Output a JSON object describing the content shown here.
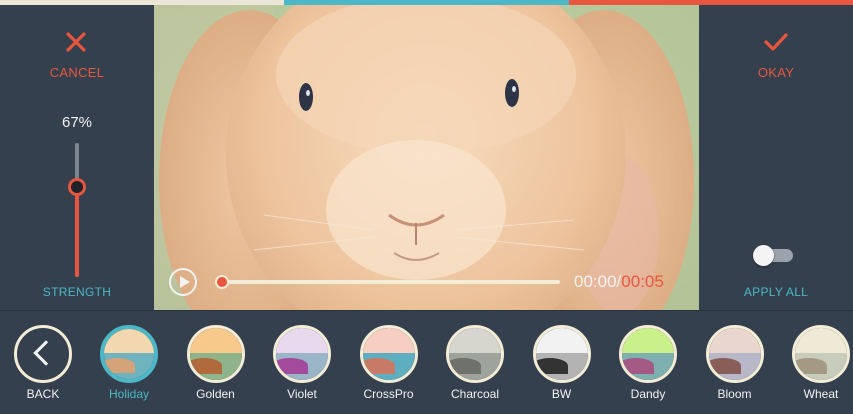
{
  "colors": {
    "panel": "#34404d",
    "accent_red": "#e8563f",
    "accent_teal": "#4bb7c7",
    "cream": "#f3ecd6",
    "strip_cream": "#ece6d6",
    "strip_teal": "#4bb7c7",
    "strip_red": "#e8563f"
  },
  "left_panel": {
    "cancel_icon": "close-icon",
    "cancel_label": "CANCEL",
    "strength_value": "67%",
    "strength_level": 0.67,
    "strength_label": "STRENGTH"
  },
  "right_panel": {
    "okay_icon": "check-icon",
    "okay_label": "OKAY",
    "apply_all_enabled": false,
    "apply_all_label": "APPLY ALL"
  },
  "player": {
    "play_icon": "play-icon",
    "current_time": "00:00",
    "separator": "/",
    "total_time": "00:05",
    "progress": 0.0
  },
  "filters": {
    "back_icon": "chevron-left-icon",
    "back_label": "BACK",
    "items": [
      {
        "label": "Holiday",
        "selected": true,
        "sky": "#f2d7b0",
        "sea": "#6fb3bf",
        "rocks": "#d4a37a"
      },
      {
        "label": "Golden",
        "selected": false,
        "sky": "#f7c98a",
        "sea": "#8fb38a",
        "rocks": "#b06a3c"
      },
      {
        "label": "Violet",
        "selected": false,
        "sky": "#e9d9ef",
        "sea": "#9ab4c8",
        "rocks": "#a34a9c"
      },
      {
        "label": "CrossPro",
        "selected": false,
        "sky": "#f6cfc2",
        "sea": "#5faec0",
        "rocks": "#c77a66"
      },
      {
        "label": "Charcoal",
        "selected": false,
        "sky": "#d6d6cf",
        "sea": "#9ea39c",
        "rocks": "#6f716c"
      },
      {
        "label": "BW",
        "selected": false,
        "sky": "#f2f2f2",
        "sea": "#b3b3b3",
        "rocks": "#333333"
      },
      {
        "label": "Dandy",
        "selected": false,
        "sky": "#c9f08a",
        "sea": "#7fb0b0",
        "rocks": "#a35a85"
      },
      {
        "label": "Bloom",
        "selected": false,
        "sky": "#e8d6cf",
        "sea": "#b7b7c7",
        "rocks": "#8a5e58"
      },
      {
        "label": "Wheat",
        "selected": false,
        "sky": "#efe9d6",
        "sea": "#c8ccbc",
        "rocks": "#a49a84"
      }
    ]
  }
}
